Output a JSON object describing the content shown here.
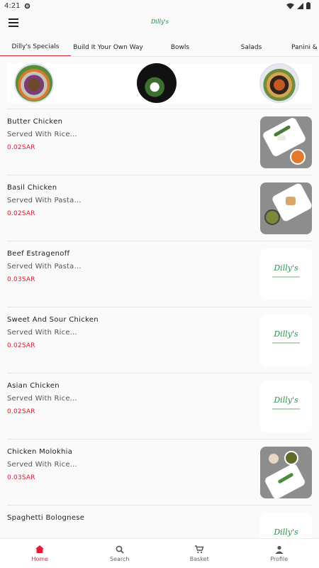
{
  "status": {
    "time": "4:21"
  },
  "header": {
    "logo_text": "Dilly's"
  },
  "tabs": [
    {
      "label": "Dilly's Specials"
    },
    {
      "label": "Build It Your Own Way"
    },
    {
      "label": "Bowls"
    },
    {
      "label": "Salads"
    },
    {
      "label": "Panini & B"
    }
  ],
  "menu": {
    "items": [
      {
        "name": "Butter Chicken",
        "description": "Served With Rice...",
        "price": "0.02SAR",
        "image": "photo"
      },
      {
        "name": "Basil Chicken",
        "description": "Served With Pasta...",
        "price": "0.02SAR",
        "image": "photo"
      },
      {
        "name": "Beef Estragenoff",
        "description": "Served With Pasta...",
        "price": "0.03SAR",
        "image": "logo"
      },
      {
        "name": "Sweet And Sour Chicken",
        "description": "Served With Rice...",
        "price": "0.02SAR",
        "image": "logo"
      },
      {
        "name": "Asian Chicken",
        "description": "Served With Rice...",
        "price": "0.02SAR",
        "image": "logo"
      },
      {
        "name": "Chicken Molokhia",
        "description": "Served With Rice...",
        "price": "0.03SAR",
        "image": "photo"
      },
      {
        "name": "Spaghetti Bolognese",
        "description": "",
        "price": "",
        "image": "logo"
      }
    ]
  },
  "bottom_nav": [
    {
      "label": "Home",
      "icon": "home-icon",
      "active": true
    },
    {
      "label": "Search",
      "icon": "search-icon",
      "active": false
    },
    {
      "label": "Basket",
      "icon": "cart-icon",
      "active": false
    },
    {
      "label": "Profile",
      "icon": "person-icon",
      "active": false
    }
  ],
  "colors": {
    "accent": "#e11d3a",
    "price": "#e3162e",
    "brand_green": "#27944a"
  }
}
